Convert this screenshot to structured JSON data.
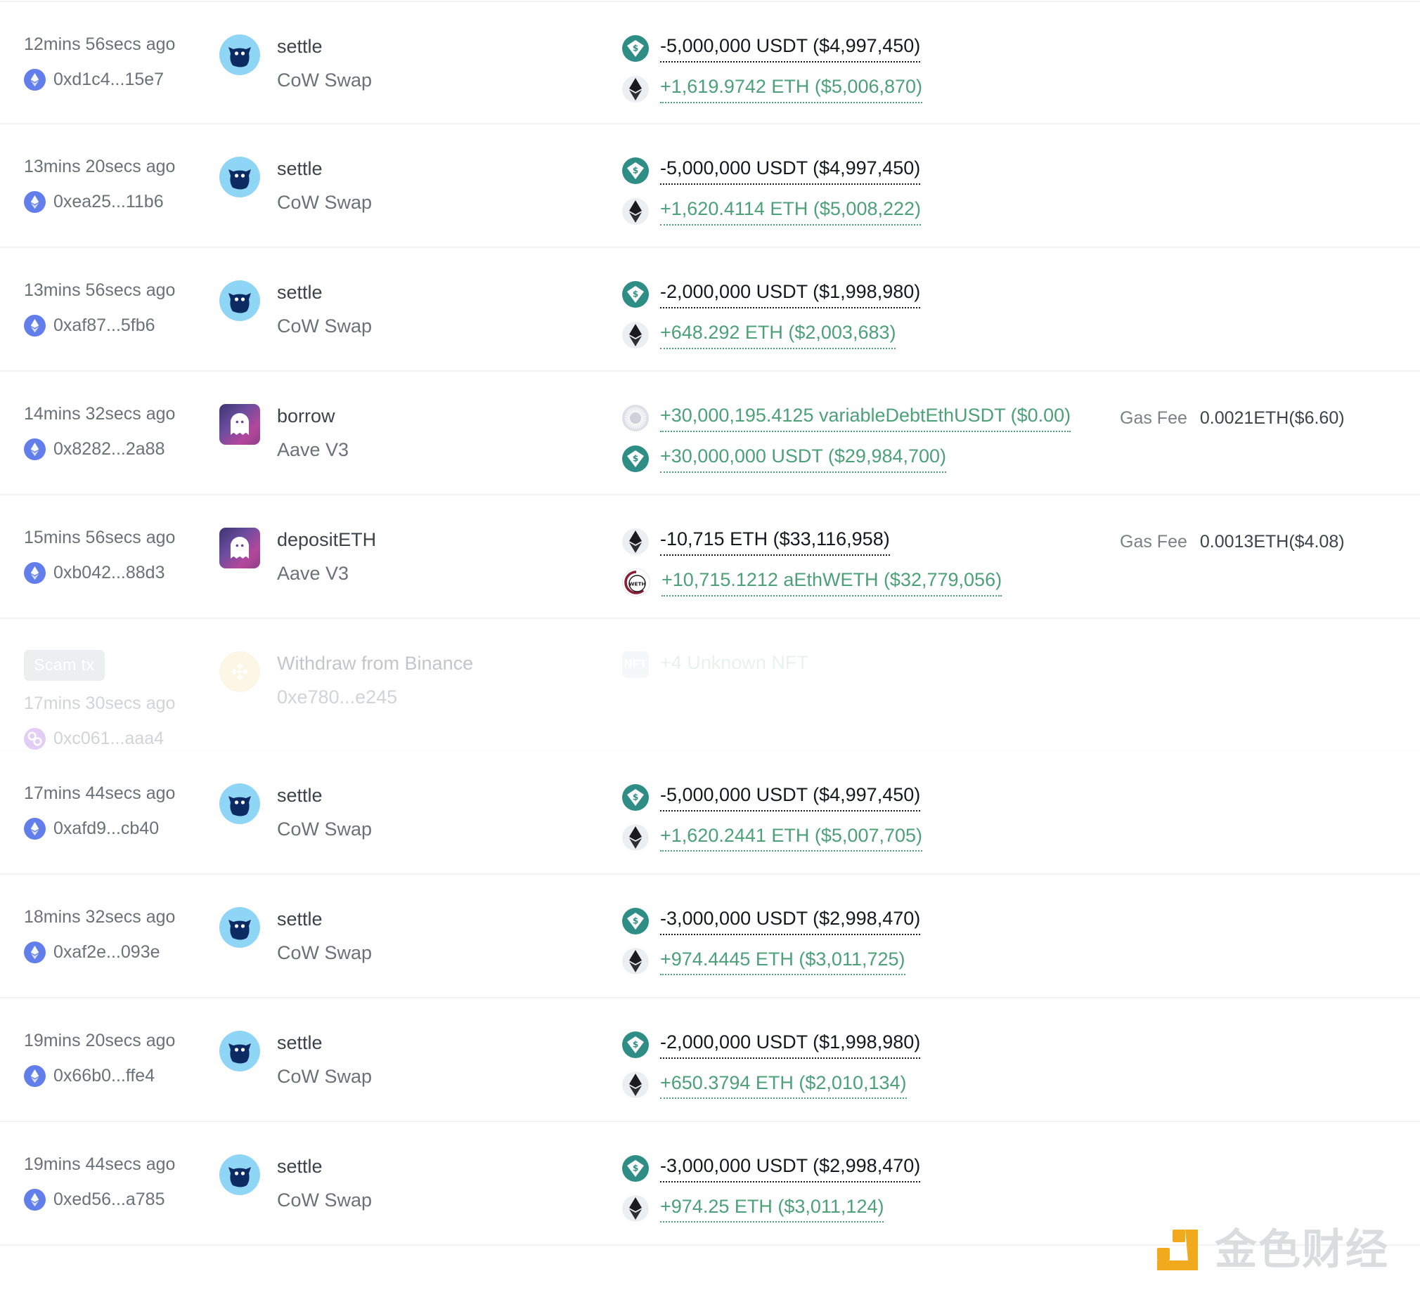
{
  "labels": {
    "gas_fee": "Gas Fee",
    "scam_badge": "Scam tx",
    "nft_icon_text": "NFT"
  },
  "colors": {
    "amount_out": "#15181c",
    "amount_in": "#4ca07a",
    "row_divider": "#f1f2f4",
    "muted_text": "#6b7177",
    "usdt_teal": "#2e8e85",
    "cow_blue": "#8fd5f6",
    "eth_violet": "#627eea",
    "scam_badge_bg": "#c7cad1",
    "watermark_orange": "#f0a30a"
  },
  "watermark": {
    "brand": "金色财经"
  },
  "rows": [
    {
      "time": "12mins 56secs ago",
      "hash": "0xd1c4...15e7",
      "chain_icon": "ethereum-icon",
      "method": "settle",
      "protocol": "CoW Swap",
      "protocol_icon": "cow-swap-icon",
      "amounts": [
        {
          "icon": "usdt-icon",
          "text": "-5,000,000 USDT ($4,997,450)",
          "dir": "out"
        },
        {
          "icon": "eth-icon",
          "text": "+1,619.9742 ETH ($5,006,870)",
          "dir": "in"
        }
      ],
      "gas_fee": "",
      "scam": false
    },
    {
      "time": "13mins 20secs ago",
      "hash": "0xea25...11b6",
      "chain_icon": "ethereum-icon",
      "method": "settle",
      "protocol": "CoW Swap",
      "protocol_icon": "cow-swap-icon",
      "amounts": [
        {
          "icon": "usdt-icon",
          "text": "-5,000,000 USDT ($4,997,450)",
          "dir": "out"
        },
        {
          "icon": "eth-icon",
          "text": "+1,620.4114 ETH ($5,008,222)",
          "dir": "in"
        }
      ],
      "gas_fee": "",
      "scam": false
    },
    {
      "time": "13mins 56secs ago",
      "hash": "0xaf87...5fb6",
      "chain_icon": "ethereum-icon",
      "method": "settle",
      "protocol": "CoW Swap",
      "protocol_icon": "cow-swap-icon",
      "amounts": [
        {
          "icon": "usdt-icon",
          "text": "-2,000,000 USDT ($1,998,980)",
          "dir": "out"
        },
        {
          "icon": "eth-icon",
          "text": "+648.292 ETH ($2,003,683)",
          "dir": "in"
        }
      ],
      "gas_fee": "",
      "scam": false
    },
    {
      "time": "14mins 32secs ago",
      "hash": "0x8282...2a88",
      "chain_icon": "ethereum-icon",
      "method": "borrow",
      "protocol": "Aave V3",
      "protocol_icon": "aave-icon",
      "amounts": [
        {
          "icon": "variable-debt-icon",
          "text": "+30,000,195.4125 variableDebtEthUSDT ($0.00)",
          "dir": "in"
        },
        {
          "icon": "usdt-icon",
          "text": "+30,000,000 USDT ($29,984,700)",
          "dir": "in"
        }
      ],
      "gas_fee": "0.0021ETH($6.60)",
      "scam": false
    },
    {
      "time": "15mins 56secs ago",
      "hash": "0xb042...88d3",
      "chain_icon": "ethereum-icon",
      "method": "depositETH",
      "protocol": "Aave V3",
      "protocol_icon": "aave-icon",
      "amounts": [
        {
          "icon": "eth-icon",
          "text": "-10,715 ETH ($33,116,958)",
          "dir": "out"
        },
        {
          "icon": "aweth-icon",
          "text": "+10,715.1212 aEthWETH ($32,779,056)",
          "dir": "in"
        }
      ],
      "gas_fee": "0.0013ETH($4.08)",
      "scam": false
    },
    {
      "time": "17mins 30secs ago",
      "hash": "0xc061...aaa4",
      "chain_icon": "polygon-icon",
      "method": "Withdraw from Binance",
      "protocol": "0xe780...e245",
      "protocol_icon": "binance-icon",
      "amounts": [
        {
          "icon": "nft-icon",
          "text": "+4 Unknown NFT",
          "dir": "nft"
        }
      ],
      "gas_fee": "",
      "scam": true
    },
    {
      "time": "17mins 44secs ago",
      "hash": "0xafd9...cb40",
      "chain_icon": "ethereum-icon",
      "method": "settle",
      "protocol": "CoW Swap",
      "protocol_icon": "cow-swap-icon",
      "amounts": [
        {
          "icon": "usdt-icon",
          "text": "-5,000,000 USDT ($4,997,450)",
          "dir": "out"
        },
        {
          "icon": "eth-icon",
          "text": "+1,620.2441 ETH ($5,007,705)",
          "dir": "in"
        }
      ],
      "gas_fee": "",
      "scam": false
    },
    {
      "time": "18mins 32secs ago",
      "hash": "0xaf2e...093e",
      "chain_icon": "ethereum-icon",
      "method": "settle",
      "protocol": "CoW Swap",
      "protocol_icon": "cow-swap-icon",
      "amounts": [
        {
          "icon": "usdt-icon",
          "text": "-3,000,000 USDT ($2,998,470)",
          "dir": "out"
        },
        {
          "icon": "eth-icon",
          "text": "+974.4445 ETH ($3,011,725)",
          "dir": "in"
        }
      ],
      "gas_fee": "",
      "scam": false
    },
    {
      "time": "19mins 20secs ago",
      "hash": "0x66b0...ffe4",
      "chain_icon": "ethereum-icon",
      "method": "settle",
      "protocol": "CoW Swap",
      "protocol_icon": "cow-swap-icon",
      "amounts": [
        {
          "icon": "usdt-icon",
          "text": "-2,000,000 USDT ($1,998,980)",
          "dir": "out"
        },
        {
          "icon": "eth-icon",
          "text": "+650.3794 ETH ($2,010,134)",
          "dir": "in"
        }
      ],
      "gas_fee": "",
      "scam": false
    },
    {
      "time": "19mins 44secs ago",
      "hash": "0xed56...a785",
      "chain_icon": "ethereum-icon",
      "method": "settle",
      "protocol": "CoW Swap",
      "protocol_icon": "cow-swap-icon",
      "amounts": [
        {
          "icon": "usdt-icon",
          "text": "-3,000,000 USDT ($2,998,470)",
          "dir": "out"
        },
        {
          "icon": "eth-icon",
          "text": "+974.25 ETH ($3,011,124)",
          "dir": "in"
        }
      ],
      "gas_fee": "",
      "scam": false
    }
  ]
}
